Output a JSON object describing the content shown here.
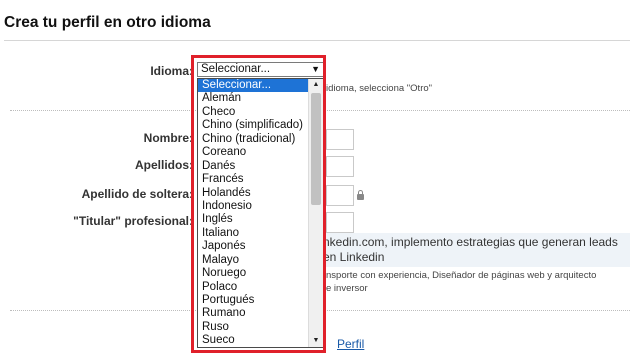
{
  "page": {
    "title": "Crea tu perfil en otro idioma"
  },
  "form": {
    "language_label": "Idioma:",
    "language_hint": "idioma, selecciona \"Otro\"",
    "first_name_label": "Nombre:",
    "last_name_label": "Apellidos:",
    "maiden_name_label": "Apellido de soltera:",
    "headline_label": "\"Titular\" profesional:",
    "headline_example_line1": "nkedin.com, implemento estrategias que generan leads",
    "headline_example_line2": "en Linkedin",
    "headline_hint_line1": "nsporte con experiencia, Diseñador de páginas web y arquitecto",
    "headline_hint_line2": "e inversor",
    "footer_link": "Perfil"
  },
  "language_select": {
    "selected": "Seleccionar...",
    "options": [
      "Seleccionar...",
      "Alemán",
      "Checo",
      "Chino (simplificado)",
      "Chino (tradicional)",
      "Coreano",
      "Danés",
      "Francés",
      "Holandés",
      "Indonesio",
      "Inglés",
      "Italiano",
      "Japonés",
      "Malayo",
      "Noruego",
      "Polaco",
      "Portugués",
      "Rumano",
      "Ruso",
      "Sueco"
    ],
    "highlighted_index": 0
  },
  "icons": {
    "lock": "lock-icon",
    "dropdown": "chevron-down-icon"
  },
  "colors": {
    "highlight": "#e0202a",
    "selected_option": "#1e73d6",
    "link": "#1a5aa8"
  }
}
